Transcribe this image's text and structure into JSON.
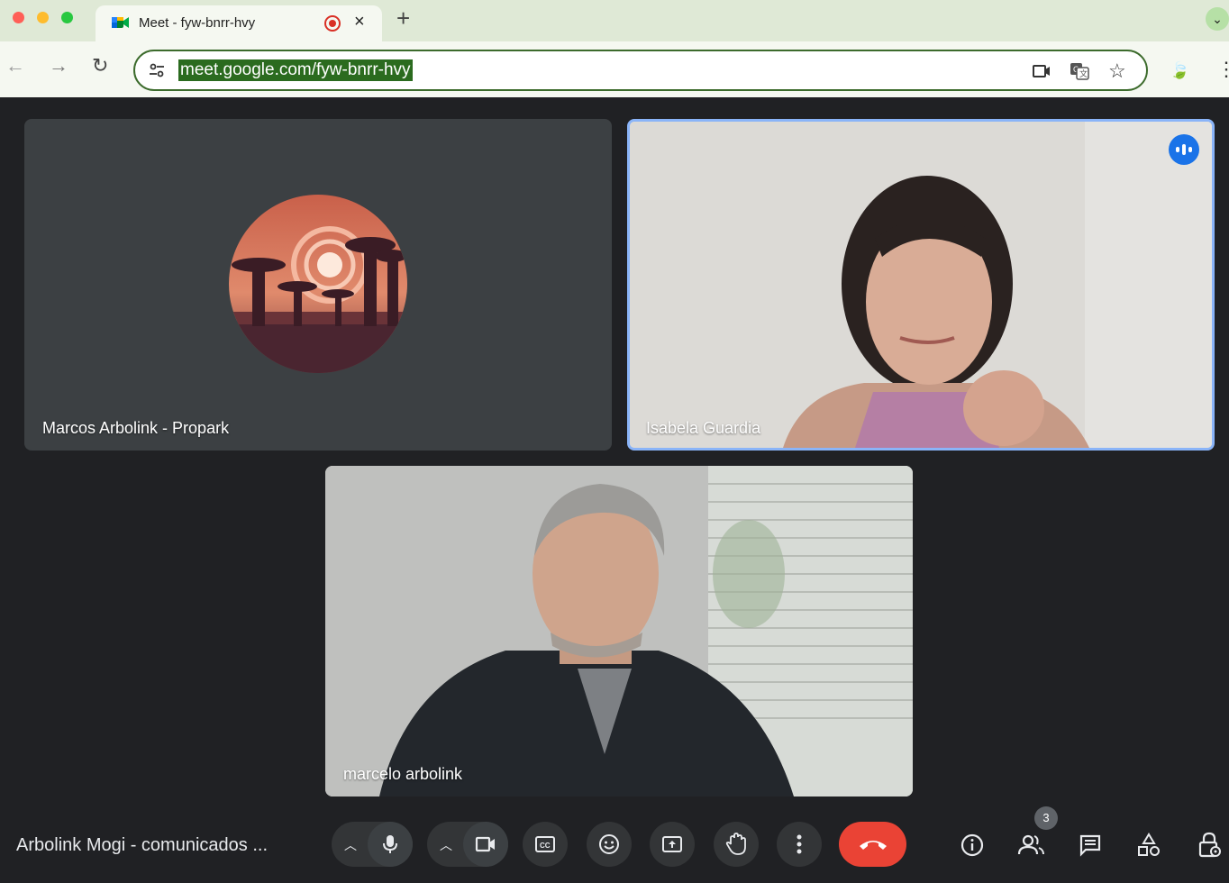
{
  "browser": {
    "tab_title": "Meet - fyw-bnrr-hvy",
    "url": "meet.google.com/fyw-bnrr-hvy",
    "new_tab_symbol": "+",
    "close_symbol": "×",
    "tab_menu_symbol": "⌄"
  },
  "participants": [
    {
      "name": "Marcos Arbolink - Propark",
      "camera": "off"
    },
    {
      "name": "Isabela Guardia",
      "camera": "on",
      "speaking": true
    },
    {
      "name": "marcelo arbolink",
      "camera": "on"
    }
  ],
  "meeting": {
    "title": "Arbolink Mogi - comunicados ...",
    "participant_count": "3"
  },
  "colors": {
    "stage_bg": "#202124",
    "tile_bg": "#3c4043",
    "active_speaker_border": "#8ab4f8",
    "end_call": "#ea4335",
    "control_bg": "#333537"
  },
  "icons": {
    "controls": [
      "chevron-up-icon",
      "microphone-icon",
      "chevron-up-icon",
      "camera-icon",
      "captions-icon",
      "emoji-icon",
      "present-icon",
      "raise-hand-icon",
      "more-options-icon",
      "end-call-icon"
    ],
    "right": [
      "info-icon",
      "people-icon",
      "chat-icon",
      "activities-icon",
      "host-controls-icon"
    ]
  }
}
